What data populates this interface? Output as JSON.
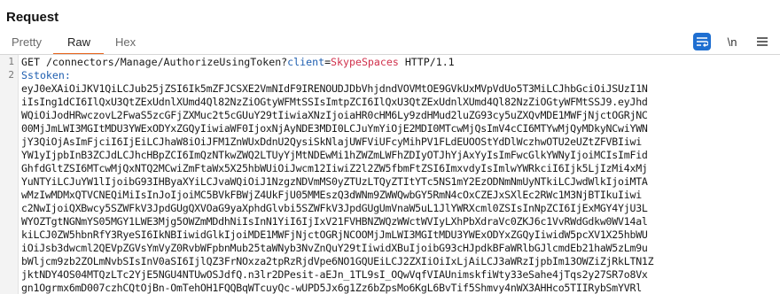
{
  "panel": {
    "title": "Request"
  },
  "tabs": [
    {
      "label": "Pretty",
      "active": false
    },
    {
      "label": "Raw",
      "active": true
    },
    {
      "label": "Hex",
      "active": false
    }
  ],
  "toolbar": {
    "newline_label": "\\n",
    "icons": [
      "pretty-print-toggle-icon",
      "show-newlines-icon",
      "menu-icon"
    ]
  },
  "editor": {
    "line_numbers": [
      "1",
      "2"
    ],
    "request_line": {
      "method": "GET",
      "path": "/connectors/Manage/AuthorizeUsingToken?",
      "param_name": "client",
      "eq": "=",
      "param_value": "SkypeSpaces",
      "version": "HTTP/1.1"
    },
    "header_name": "Sstoken:",
    "token_lines": [
      "eyJ0eXAiOiJKV1QiLCJub25jZSI6Ik5mZFJCSXE2VmNIdF9IRENOUDJDbVhjdndVOVMtOE9GVkUxMVpVdUo5T3MiLCJhbGciOiJSUzI1N",
      "iIsIng1dCI6IlQxU3QtZExUdnlXUmd4Ql82NzZiOGtyWFMtSSIsImtpZCI6IlQxU3QtZExUdnlXUmd4Ql82NzZiOGtyWFMtSSJ9.eyJhd",
      "WQiOiJodHRwczovL2FwaS5zcGFjZXMuc2t5cGUuY29tIiwiaXNzIjoiaHR0cHM6Ly9zdHMud2luZG93cy5uZXQvMDE1MWFjNjctOGRjNC",
      "00MjJmLWI3MGItMDU3YWExODYxZGQyIiwiaWF0IjoxNjAyNDE3MDI0LCJuYmYiOjE2MDI0MTcwMjQsImV4cCI6MTYwMjQyMDkyNCwiYWN",
      "jY3QiOjAsImFjciI6IjEiLCJhaW8iOiJFM1ZnWUxDdnU2QysiSkNlajUWFViUFcyMihPV1FLdEUOOStYdDlWczhwOTU2eUZtZFVBIiwi",
      "YW1yIjpbInB3ZCJdLCJhcHBpZCI6ImQzNTkwZWQ2LTUyYjMtNDEwMi1hZWZmLWFhZDIyOTJhYjAxYyIsImFwcGlkYWNyIjoiMCIsImFid",
      "GhfdGltZSI6MTcwMjQxNTQ2MCwiZmFtaWx5X25hbWUiOiJwcm12IiwiZ2l2ZW5fbmFtZSI6ImxvdyIsImlwYWRkciI6Ijk5LjIzMi4xMj",
      "YuNTYiLCJuYW1lIjoibG93IHByaXYiLCJvaWQiOiJ1NzgzNDVmMS0yZTUzLTQyZTItYTc5NS1mY2EzODNmNmUyNTkiLCJwdWlkIjoiMTA",
      "wMzIwMDMxQTVCNEQiMiIsInJoIjoiMC5BVkFBWjZ4UkFjU05MMEszQ3dWNm9ZWWQwbGY5RmN4cOxCZEJxSXlEc2RWc1M3NjBTIkuIiwi",
      "c2NwIjoiQXBwcy5SZWFkV3JpdGUgQXVOaG9yaXphdGlvbi5SZWFkV3JpdGUgUmVnaW5uL1JlYWRXcml0ZSIsInNpZCI6IjExMGY4YjU3L",
      "WYOZTgtNGNmYS05MGY1LWE3Mjg5OWZmMDdhNiIsInN1YiI6IjIxV21FVHBNZWQzWWctWVIyLXhPbXdraVc0ZKJ6c1VvRWdGdkw0WV14al",
      "kiLCJ0ZW5hbnRfY3RyeSI6IkNBIiwidGlkIjoiMDE1MWFjNjctOGRjNCOOMjJmLWI3MGItMDU3YWExODYxZGQyIiwidW5pcXV1X25hbWU",
      "iOiJsb3dwcml2QEVpZGVsYmVyZ0RvbWFpbnMub25taWNyb3NvZnQuY29tIiwidXBuIjoibG93cHJpdkBFaWRlbGJlcmdEb21haW5zLm9u",
      "bWljcm9zb2ZOLmNvbSIsInV0aSI6IjlQZ3FrNOxza2tpRzRjdVpe6NO1GQUEiLCJ2ZXIiOiIxLjAiLCJ3aWRzIjpbIm13OWZiZjRkLTN1Z",
      "jktNDY4OS04MTQzLTc2YjE5NGU4NTUwOSJdfQ.n3lr2DPesit-aEJn_1TL9sI_OQwVqfVIAUnimskfiWty33eSahe4jTqs2y27SR7o8Vx",
      "gn1Ogrmx6mD007czhCQtOjBn-OmTehOH1FQQBqWTcuyQc-wUPD5Jx6g1Zz6bZpsMo6KgL6BvTif5Shmvy4nWX3AHHco5TIIRybSmYVRl"
    ]
  }
}
